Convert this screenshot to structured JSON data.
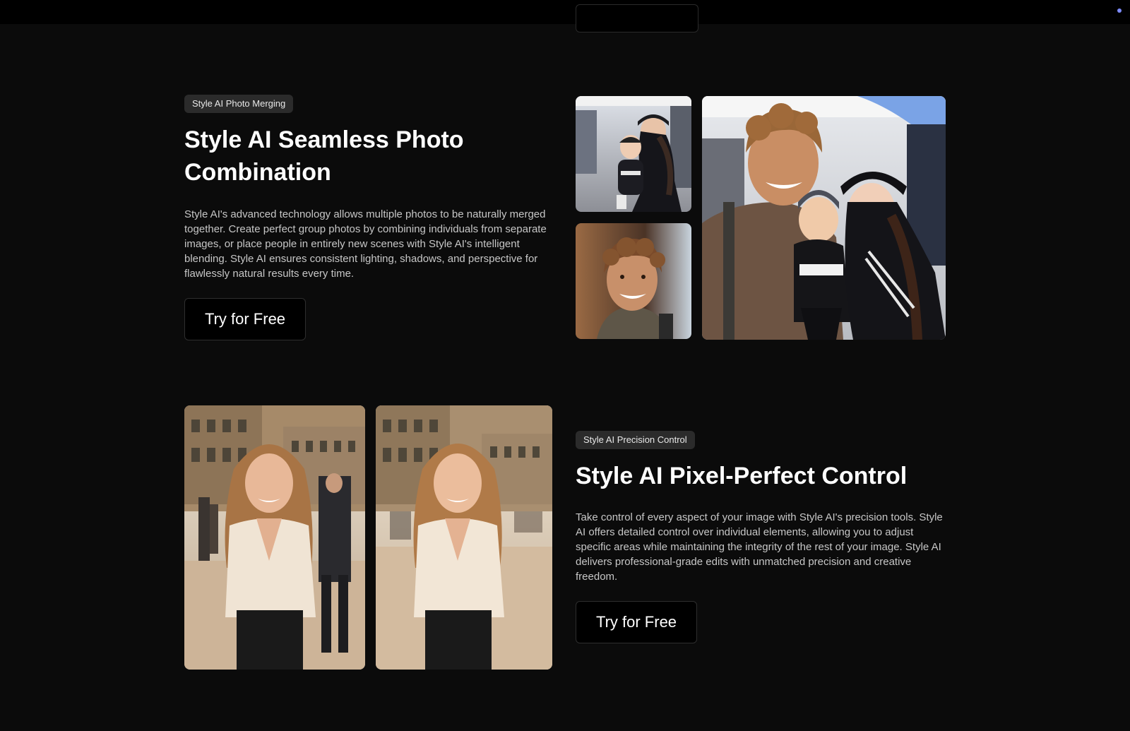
{
  "colors": {
    "page_background": "#0b0b0b",
    "topbar_background": "#000000",
    "badge_background": "#2b2b2b",
    "description_text": "#c7c7c7",
    "accent_dot": "#7e8cff"
  },
  "topbar": {
    "indicator_icon": "dot-icon"
  },
  "sections": [
    {
      "badge": "Style AI Photo Merging",
      "title": "Style AI Seamless Photo Combination",
      "description": "Style AI's advanced technology allows multiple photos to be naturally merged together. Create perfect group photos by combining individuals from separate images, or place people in entirely new scenes with Style AI's intelligent blending. Style AI ensures consistent lighting, shadows, and perspective for flawlessly natural results every time.",
      "cta_label": "Try for Free",
      "images": [
        "woman-holding-baby-photo",
        "smiling-young-man-portrait",
        "merged-family-photo"
      ]
    },
    {
      "badge": "Style AI Precision Control",
      "title": "Style AI Pixel-Perfect Control",
      "description": "Take control of every aspect of your image with Style AI's precision tools. Style AI offers detailed control over individual elements, allowing you to adjust specific areas while maintaining the integrity of the rest of your image. Style AI delivers professional-grade edits with unmatched precision and creative freedom.",
      "cta_label": "Try for Free",
      "images": [
        "woman-in-city-square-before",
        "woman-in-city-square-after"
      ]
    }
  ]
}
